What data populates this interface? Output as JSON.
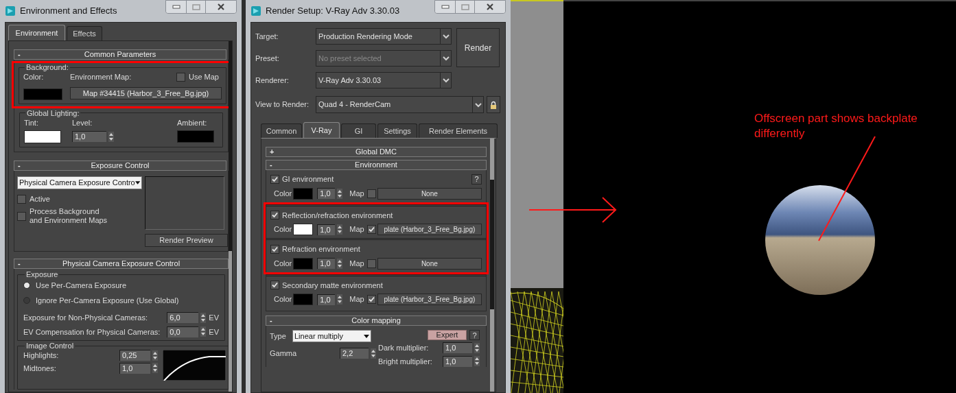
{
  "env_window": {
    "title": "Environment and Effects",
    "tabs": [
      {
        "label": "Environment",
        "selected": true
      },
      {
        "label": "Effects",
        "selected": false
      }
    ],
    "common_parameters": {
      "toggle": "-",
      "title": "Common Parameters",
      "background": {
        "label": "Background:",
        "highlighted": true,
        "color_label": "Color:",
        "color": "#000000",
        "map_label": "Environment Map:",
        "use_map": {
          "label": "Use Map",
          "checked": false
        },
        "map_button": "Map #34415 (Harbor_3_Free_Bg.jpg)"
      },
      "global_lighting": {
        "label": "Global Lighting:",
        "tint": {
          "label": "Tint:",
          "color": "#ffffff"
        },
        "level_label": "Level:",
        "level_value": "1,0",
        "ambient": {
          "label": "Ambient:",
          "color": "#000000"
        }
      }
    },
    "exposure_control": {
      "toggle": "-",
      "title": "Exposure Control",
      "dropdown": "Physical Camera Exposure Contro",
      "options": [
        {
          "label": "Active",
          "checked": false
        },
        {
          "label": "Process Background and Environment Maps",
          "checked": false
        }
      ],
      "preview_button": "Render Preview"
    },
    "physical_camera": {
      "toggle": "-",
      "title": "Physical Camera Exposure Control",
      "exposure": {
        "label": "Exposure",
        "radios": [
          {
            "label": "Use Per-Camera Exposure",
            "selected": true
          },
          {
            "label": "Ignore Per-Camera Exposure (Use Global)",
            "selected": false
          }
        ],
        "fields": [
          {
            "label": "Exposure for Non-Physical Cameras:",
            "value": "6,0",
            "unit": "EV"
          },
          {
            "label": "EV Compensation for Physical Cameras:",
            "value": "0,0",
            "unit": "EV"
          }
        ]
      },
      "image_control": {
        "label": "Image Control",
        "fields": [
          {
            "label": "Highlights:",
            "value": "0,25"
          },
          {
            "label": "Midtones:",
            "value": "1,0"
          }
        ]
      }
    }
  },
  "render_window": {
    "title": "Render Setup: V-Ray Adv 3.30.03",
    "rows": [
      {
        "label": "Target:",
        "value": "Production Rendering Mode",
        "disabled": false
      },
      {
        "label": "Preset:",
        "value": "No preset selected",
        "disabled": true
      },
      {
        "label": "Renderer:",
        "value": "V-Ray Adv 3.30.03",
        "disabled": false
      }
    ],
    "render_button": "Render",
    "view": {
      "label": "View to Render:",
      "value": "Quad 4 - RenderCam"
    },
    "tabs": [
      {
        "label": "Common",
        "selected": false
      },
      {
        "label": "V-Ray",
        "selected": true
      },
      {
        "label": "GI",
        "selected": false
      },
      {
        "label": "Settings",
        "selected": false
      },
      {
        "label": "Render Elements",
        "selected": false
      }
    ],
    "global_dmc": {
      "toggle": "+",
      "title": "Global DMC"
    },
    "environment": {
      "toggle": "-",
      "title": "Environment",
      "help": "?",
      "items": [
        {
          "label": "GI environment",
          "checked": true,
          "highlighted": false,
          "color_label": "Color",
          "color": "#000000",
          "multiplier": "1,0",
          "map_label": "Map",
          "map_checked": false,
          "map": "None"
        },
        {
          "label": "Reflection/refraction environment",
          "checked": true,
          "highlighted": true,
          "color_label": "Color",
          "color": "#ffffff",
          "multiplier": "1,0",
          "map_label": "Map",
          "map_checked": true,
          "map": "plate (Harbor_3_Free_Bg.jpg)"
        },
        {
          "label": "Refraction environment",
          "checked": true,
          "highlighted": true,
          "color_label": "Color",
          "color": "#000000",
          "multiplier": "1,0",
          "map_label": "Map",
          "map_checked": false,
          "map": "None"
        },
        {
          "label": "Secondary matte environment",
          "checked": true,
          "highlighted": false,
          "color_label": "Color",
          "color": "#000000",
          "multiplier": "1,0",
          "map_label": "Map",
          "map_checked": true,
          "map": "plate (Harbor_3_Free_Bg.jpg)"
        }
      ]
    },
    "color_mapping": {
      "toggle": "-",
      "title": "Color mapping",
      "type_label": "Type",
      "type": "Linear multiply",
      "expert_button": "Expert",
      "help": "?",
      "gamma_label": "Gamma",
      "gamma": "2,2",
      "fields": [
        {
          "label": "Dark multiplier:",
          "value": "1,0"
        },
        {
          "label": "Bright multiplier:",
          "value": "1,0"
        }
      ]
    }
  },
  "render_view": {
    "annotation": "Offscreen part shows backplate differently"
  }
}
